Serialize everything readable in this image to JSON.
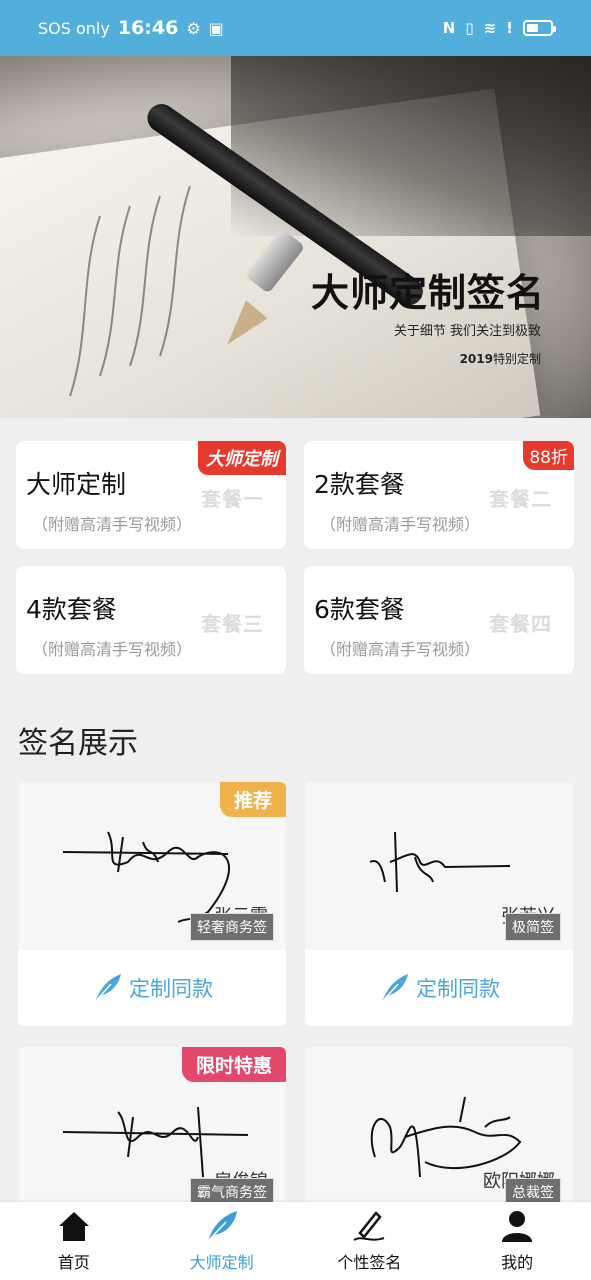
{
  "status_bar": {
    "carrier": "SOS only",
    "time": "16:46",
    "right_text": "N",
    "battery_level": 0.45
  },
  "banner": {
    "title": "大师定制签名",
    "subtitle": "关于细节 我们关注到极致",
    "year": "2019",
    "year_suffix": "特别定制"
  },
  "packages": [
    {
      "name": "大师定制",
      "note": "（附赠高清手写视频）",
      "tag": "套餐一",
      "badge": "大师定制"
    },
    {
      "name": "2款套餐",
      "note": "（附赠高清手写视频）",
      "tag": "套餐二",
      "badge": "88折"
    },
    {
      "name": "4款套餐",
      "note": "（附赠高清手写视频）",
      "tag": "套餐三",
      "badge": ""
    },
    {
      "name": "6款套餐",
      "note": "（附赠高清手写视频）",
      "tag": "套餐四",
      "badge": ""
    }
  ],
  "section": {
    "title": "签名展示"
  },
  "samples": [
    {
      "name": "张云霄",
      "type": "轻奢商务签",
      "corner": "推荐",
      "corner_color": "#f0b24a",
      "action": "定制同款"
    },
    {
      "name": "张若兴",
      "type": "极简签",
      "corner": "",
      "corner_color": "",
      "action": "定制同款"
    },
    {
      "name": "房俊锦",
      "type": "霸气商务签",
      "corner": "限时特惠",
      "corner_color": "#e2486a",
      "action": ""
    },
    {
      "name": "欧阳娜娜",
      "type": "总裁签",
      "corner": "",
      "corner_color": "",
      "action": ""
    }
  ],
  "nav": [
    {
      "label": "首页",
      "icon": "home-icon"
    },
    {
      "label": "大师定制",
      "icon": "feather-icon"
    },
    {
      "label": "个性签名",
      "icon": "pen-icon"
    },
    {
      "label": "我的",
      "icon": "user-icon"
    }
  ],
  "colors": {
    "accent": "#52afdc",
    "nav_active": "#3a9fd8",
    "badge_red": "#e63a2e"
  }
}
